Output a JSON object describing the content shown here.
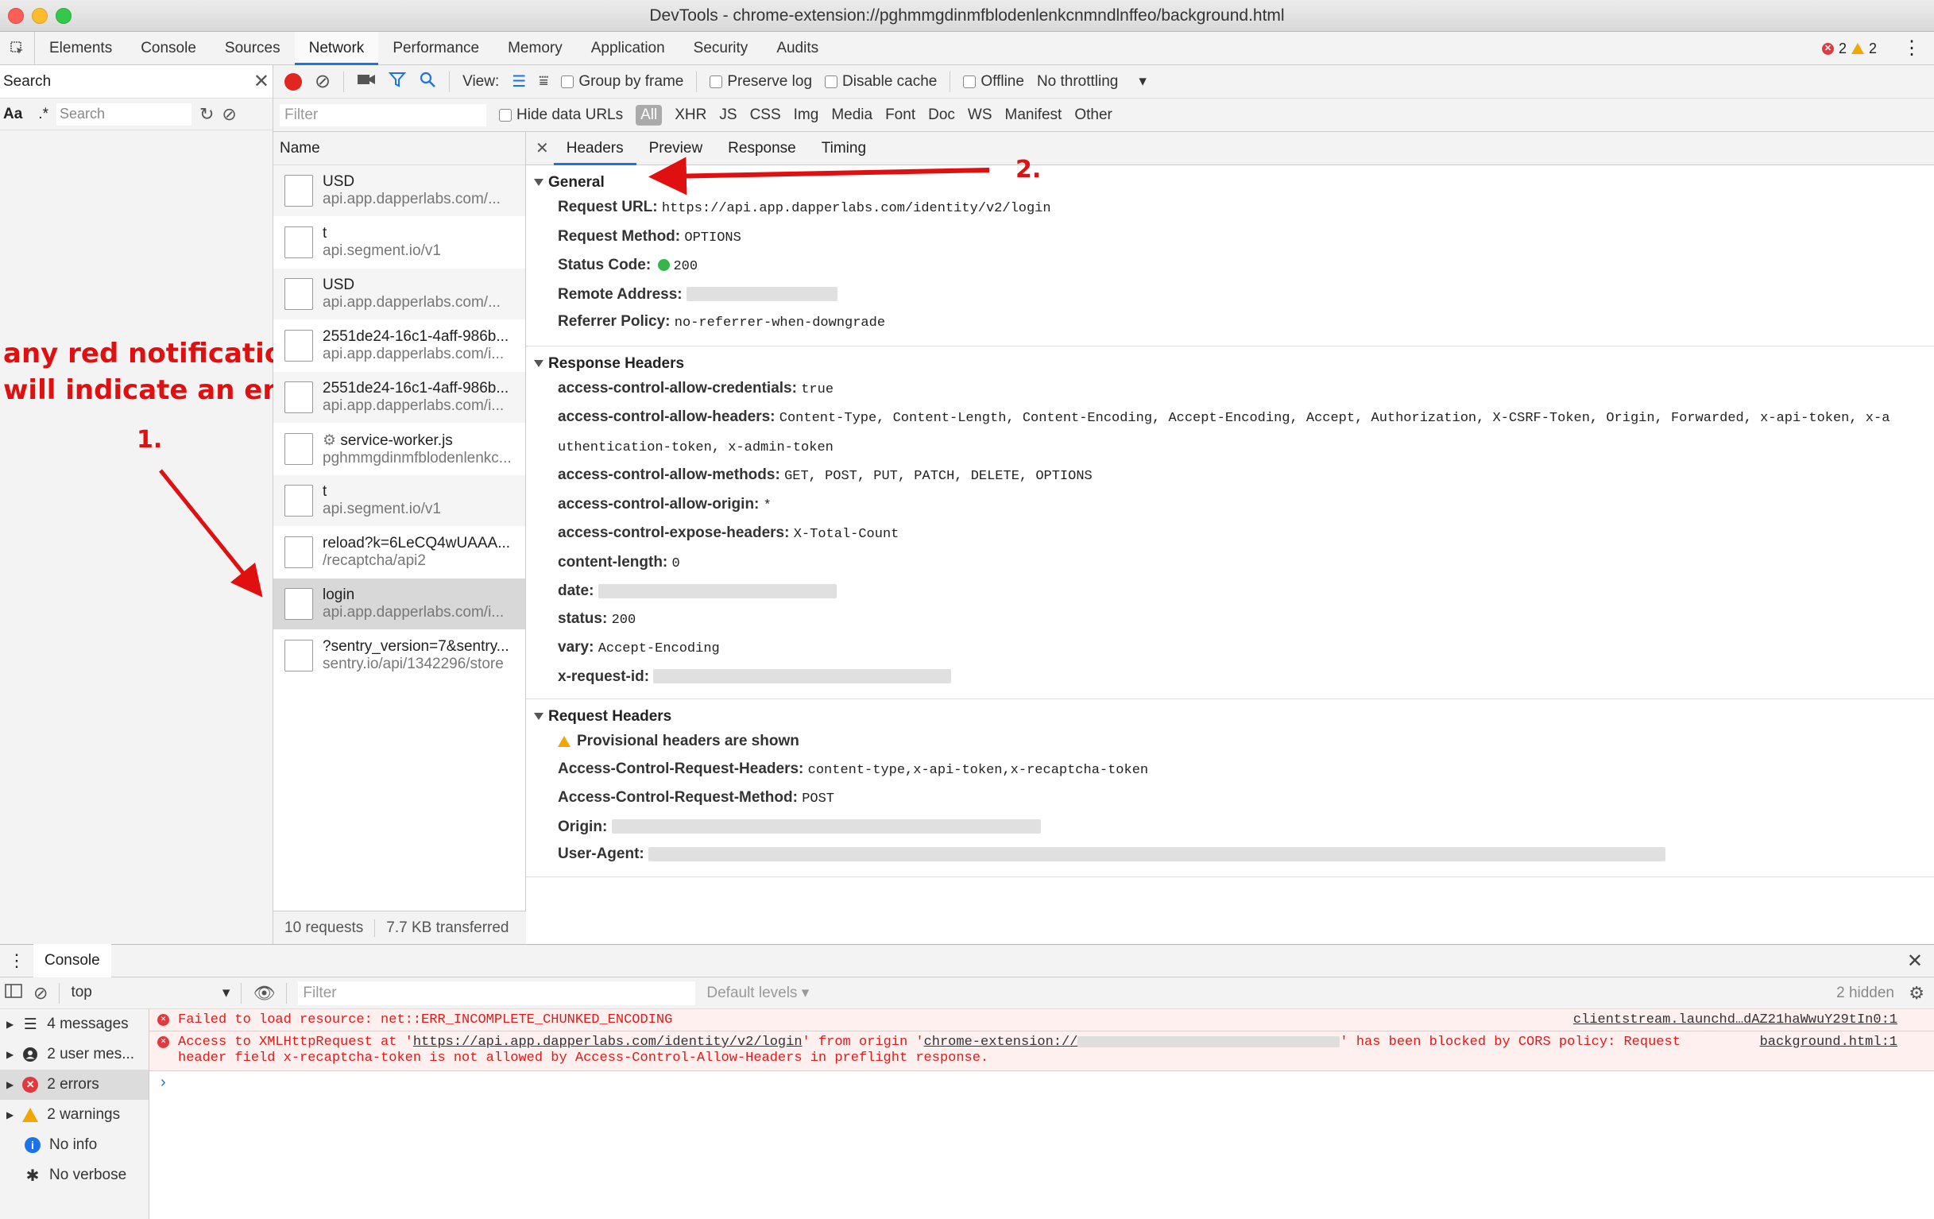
{
  "window": {
    "title": "DevTools - chrome-extension://pghmmgdinmfblodenlenkcnmndlnffeo/background.html"
  },
  "main_tabs": [
    {
      "label": "Elements"
    },
    {
      "label": "Console"
    },
    {
      "label": "Sources"
    },
    {
      "label": "Network"
    },
    {
      "label": "Performance"
    },
    {
      "label": "Memory"
    },
    {
      "label": "Application"
    },
    {
      "label": "Security"
    },
    {
      "label": "Audits"
    }
  ],
  "status": {
    "errors": "2",
    "warnings": "2"
  },
  "search_panel": {
    "title": "Search",
    "case_label": "Aa",
    "regex_label": ".*",
    "placeholder": "Search"
  },
  "annotation_left": {
    "line1": "any red notifications",
    "line2": "will indicate an error"
  },
  "annotation_1": "1.",
  "annotation_2": "2.",
  "network_toolbar": {
    "view_label": "View:",
    "group_by_frame": "Group by frame",
    "preserve_log": "Preserve log",
    "disable_cache": "Disable cache",
    "offline": "Offline",
    "throttling": "No throttling"
  },
  "filter_bar": {
    "placeholder": "Filter",
    "hide_data_urls": "Hide data URLs",
    "types": [
      "All",
      "XHR",
      "JS",
      "CSS",
      "Img",
      "Media",
      "Font",
      "Doc",
      "WS",
      "Manifest",
      "Other"
    ]
  },
  "request_list": {
    "header": "Name",
    "items": [
      {
        "name": "USD",
        "sub": "api.app.dapperlabs.com/..."
      },
      {
        "name": "t",
        "sub": "api.segment.io/v1"
      },
      {
        "name": "USD",
        "sub": "api.app.dapperlabs.com/..."
      },
      {
        "name": "2551de24-16c1-4aff-986b...",
        "sub": "api.app.dapperlabs.com/i..."
      },
      {
        "name": "2551de24-16c1-4aff-986b...",
        "sub": "api.app.dapperlabs.com/i..."
      },
      {
        "name": "service-worker.js",
        "sub": "pghmmgdinmfblodenlenkc..."
      },
      {
        "name": "t",
        "sub": "api.segment.io/v1"
      },
      {
        "name": "reload?k=6LeCQ4wUAAA...",
        "sub": "/recaptcha/api2"
      },
      {
        "name": "login",
        "sub": "api.app.dapperlabs.com/i..."
      },
      {
        "name": "?sentry_version=7&sentry...",
        "sub": "sentry.io/api/1342296/store"
      }
    ],
    "footer_requests": "10 requests",
    "footer_transferred": "7.7 KB transferred"
  },
  "detail_tabs": [
    "Headers",
    "Preview",
    "Response",
    "Timing"
  ],
  "general": {
    "title": "General",
    "request_url_label": "Request URL:",
    "request_url": "https://api.app.dapperlabs.com/identity/v2/login",
    "method_label": "Request Method:",
    "method": "OPTIONS",
    "status_label": "Status Code:",
    "status": "200",
    "remote_label": "Remote Address:",
    "referrer_label": "Referrer Policy:",
    "referrer": "no-referrer-when-downgrade"
  },
  "response_headers": {
    "title": "Response Headers",
    "rows": [
      {
        "key": "access-control-allow-credentials:",
        "value": "true"
      },
      {
        "key": "access-control-allow-headers:",
        "value": "Content-Type, Content-Length, Content-Encoding, Accept-Encoding, Accept, Authorization, X-CSRF-Token, Origin, Forwarded, x-api-token, x-a"
      },
      {
        "key": "",
        "value": "uthentication-token, x-admin-token"
      },
      {
        "key": "access-control-allow-methods:",
        "value": "GET, POST, PUT, PATCH, DELETE, OPTIONS"
      },
      {
        "key": "access-control-allow-origin:",
        "value": "*"
      },
      {
        "key": "access-control-expose-headers:",
        "value": "X-Total-Count"
      },
      {
        "key": "content-length:",
        "value": "0"
      },
      {
        "key": "date:",
        "value": ""
      },
      {
        "key": "status:",
        "value": "200"
      },
      {
        "key": "vary:",
        "value": "Accept-Encoding"
      },
      {
        "key": "x-request-id:",
        "value": ""
      }
    ]
  },
  "request_headers": {
    "title": "Request Headers",
    "provisional": "Provisional headers are shown",
    "rows": [
      {
        "key": "Access-Control-Request-Headers:",
        "value": "content-type,x-api-token,x-recaptcha-token"
      },
      {
        "key": "Access-Control-Request-Method:",
        "value": "POST"
      },
      {
        "key": "Origin:",
        "value": ""
      },
      {
        "key": "User-Agent:",
        "value": ""
      }
    ]
  },
  "console": {
    "drawer_title": "Console",
    "context": "top",
    "filter_placeholder": "Filter",
    "levels": "Default levels",
    "hidden": "2 hidden",
    "sidebar": [
      {
        "label": "4 messages",
        "icon": "list-icon"
      },
      {
        "label": "2 user mes...",
        "icon": "user-icon"
      },
      {
        "label": "2 errors",
        "icon": "error-icon"
      },
      {
        "label": "2 warnings",
        "icon": "warning-icon"
      },
      {
        "label": "No info",
        "icon": "info-icon"
      },
      {
        "label": "No verbose",
        "icon": "bug-icon"
      }
    ],
    "messages": [
      {
        "text": "Failed to load resource: net::ERR_INCOMPLETE_CHUNKED_ENCODING",
        "source": "clientstream.launchd…dAZ21haWwuY29tIn0:1"
      },
      {
        "line1_a": "Access to XMLHttpRequest at '",
        "url": "https://api.app.dapperlabs.com/identity/v2/login",
        "line1_b": "' from origin '",
        "origin": "chrome-extension://",
        "line1_c": "' has been blocked by CORS policy: Request",
        "line2": "header field x-recaptcha-token is not allowed by Access-Control-Allow-Headers in preflight response.",
        "source": "background.html:1"
      }
    ]
  },
  "colors": {
    "accent": "#1a73e8",
    "error": "#e01a1a",
    "annotation": "#e01010"
  }
}
